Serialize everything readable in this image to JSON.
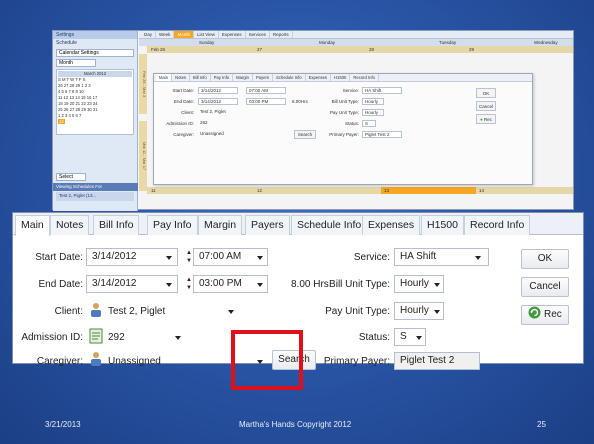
{
  "slide": {
    "date": "3/21/2013",
    "copyright": "Martha's Hands Copyright 2012",
    "page_number": "25",
    "accent_color": "#e0101a"
  },
  "background_screenshot": {
    "left_panel": {
      "settings_label": "Settings",
      "schedule_label": "Schedule",
      "calendar_settings_label": "Calendar Settings",
      "view_select": "Month",
      "month_title": "March 2012",
      "weekday_header": "S M T W T F S",
      "calendar_rows": [
        "26 27 28 29 1 2 3",
        "4 5 6 7 8 9 10",
        "11 12 13 14 15 16 17",
        "18 19 20 21 22 23 24",
        "25 26 27 28 29 30 31",
        "1 2 3 4 5 6 7"
      ],
      "today": "14",
      "select_label": "Select",
      "viewing_label": "Viewing Schedules For",
      "client_item": "Test 2, Piglet (13..."
    },
    "view_tabs": [
      "Day",
      "Week",
      "Month",
      "List View",
      "Expenses",
      "Services",
      "Reports"
    ],
    "active_view_tab": "Month",
    "day_headers": [
      "Sunday",
      "Monday",
      "Tuesday",
      "Wednesday"
    ],
    "week_dates": [
      "Feb 26",
      "27",
      "28",
      "29"
    ],
    "week_dates_2": [
      "11",
      "12",
      "13",
      "14"
    ],
    "week_labels": [
      "Feb 26 - Mar 3",
      "Mar 11 - Mar 17"
    ],
    "dialog": {
      "tabs": [
        "Main",
        "Notes",
        "Bill Info",
        "Pay Info",
        "Margin",
        "Payers",
        "Schedule Info",
        "Expenses",
        "H1500",
        "Record Info"
      ],
      "start_date_label": "Start Date:",
      "start_date": "3/14/2012",
      "start_time": "07:00 AM",
      "end_date_label": "End Date:",
      "end_date": "3/14/2012",
      "end_time": "03:00 PM",
      "hours": "8.00Hrs",
      "client_label": "Client:",
      "client": "Test 2, Piglet",
      "admission_label": "Admission ID:",
      "admission": "292",
      "caregiver_label": "Caregiver:",
      "caregiver": "Unassigned",
      "search": "Search",
      "service_label": "Service:",
      "service": "HA Shift",
      "bill_unit_label": "Bill Unit Type:",
      "bill_unit": "Hourly",
      "pay_unit_label": "Pay Unit Type:",
      "pay_unit": "Hourly",
      "status_label": "Status:",
      "status": "S",
      "primary_payer_label": "Primary Payer:",
      "primary_payer": "Piglet Test 2",
      "ok": "OK",
      "cancel": "Cancel",
      "rec": "Rec"
    }
  },
  "dialog": {
    "tabs": [
      "Main",
      "Notes",
      "Bill Info",
      "Pay Info",
      "Margin",
      "Payers",
      "Schedule Info",
      "Expenses",
      "H1500",
      "Record Info"
    ],
    "active_tab": "Main",
    "start_date_label": "Start Date:",
    "start_date": "3/14/2012",
    "start_time": "07:00 AM",
    "end_date_label": "End Date:",
    "end_date": "3/14/2012",
    "end_time": "03:00 PM",
    "duration": "8.00 Hrs",
    "client_label": "Client:",
    "client": "Test 2, Piglet",
    "admission_label": "Admission ID:",
    "admission_id": "292",
    "caregiver_label": "Caregiver:",
    "caregiver": "Unassigned",
    "search_label": "Search",
    "service_label": "Service:",
    "service": "HA Shift",
    "bill_unit_label": "Bill Unit Type:",
    "bill_unit": "Hourly",
    "pay_unit_label": "Pay Unit Type:",
    "pay_unit": "Hourly",
    "status_label": "Status:",
    "status": "S",
    "primary_payer_label": "Primary Payer:",
    "primary_payer": "Piglet Test 2",
    "ok_label": "OK",
    "cancel_label": "Cancel",
    "rec_label": "Rec"
  }
}
